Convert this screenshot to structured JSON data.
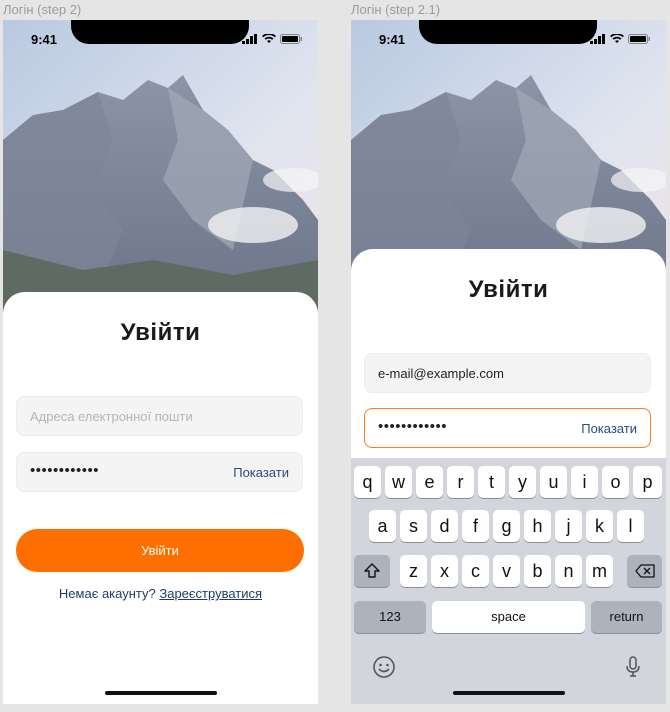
{
  "frames": [
    {
      "label": "Логін (step 2)",
      "status_time": "9:41",
      "title": "Увійти",
      "email_placeholder": "Адреса електронної пошти",
      "password_dots": "••••••••••••",
      "show_label": "Показати",
      "login_button": "Увійти",
      "no_account": "Немає акаунту?",
      "register_link": "Зареєструватися"
    },
    {
      "label": "Логін (step 2.1)",
      "status_time": "9:41",
      "title": "Увійти",
      "email_value": "e-mail@example.com",
      "password_dots": "••••••••••••",
      "show_label": "Показати",
      "keyboard": {
        "row1": [
          "q",
          "w",
          "e",
          "r",
          "t",
          "y",
          "u",
          "i",
          "o",
          "p"
        ],
        "row2": [
          "a",
          "s",
          "d",
          "f",
          "g",
          "h",
          "j",
          "k",
          "l"
        ],
        "row3": [
          "z",
          "x",
          "c",
          "v",
          "b",
          "n",
          "m"
        ],
        "numbers_key": "123",
        "space_key": "space",
        "return_key": "return"
      }
    }
  ],
  "colors": {
    "accent": "#ff6f00",
    "focus_border": "#ff7a1a",
    "link": "#1f3b66",
    "keyboard_bg": "#d2d5db"
  },
  "icons": [
    "signal-icon",
    "wifi-icon",
    "battery-icon",
    "shift-icon",
    "backspace-icon",
    "emoji-icon",
    "microphone-icon"
  ]
}
